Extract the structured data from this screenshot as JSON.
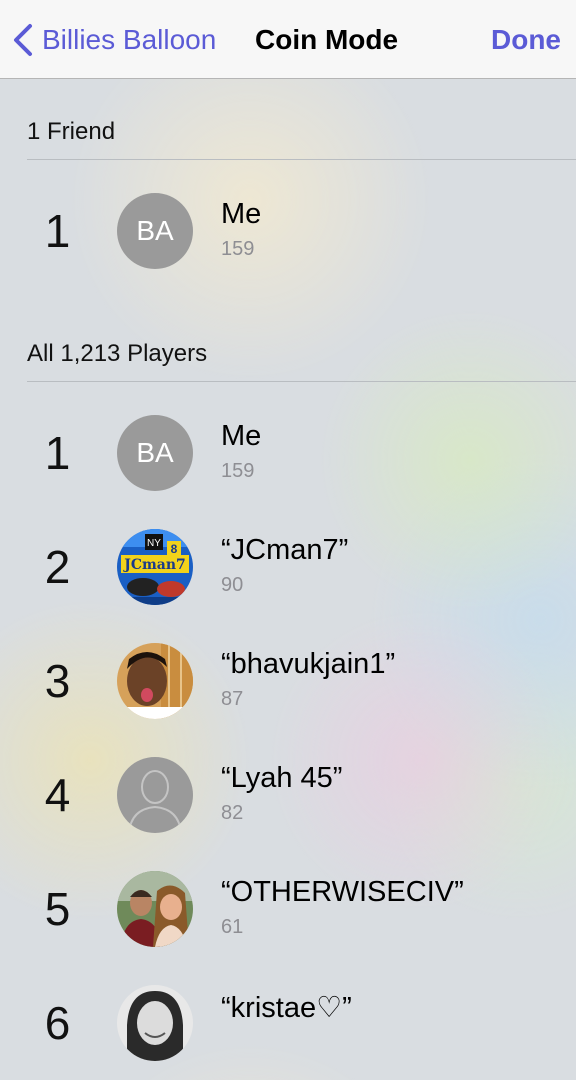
{
  "nav": {
    "back_label": "Billies Balloon",
    "title": "Coin Mode",
    "done_label": "Done"
  },
  "friends_section": {
    "header": "1 Friend",
    "rows": [
      {
        "rank": "1",
        "initials": "BA",
        "name": "Me",
        "score": "159"
      }
    ]
  },
  "players_section": {
    "header": "All 1,213 Players",
    "rows": [
      {
        "rank": "1",
        "initials": "BA",
        "name": "Me",
        "score": "159"
      },
      {
        "rank": "2",
        "name": "“JCman7”",
        "score": "90",
        "avatar_text": "JCman7",
        "avatar_badge": "8",
        "avatar_logo": "NY"
      },
      {
        "rank": "3",
        "name": "“bhavukjain1”",
        "score": "87"
      },
      {
        "rank": "4",
        "name": "“Lyah 45”",
        "score": "82"
      },
      {
        "rank": "5",
        "name": "“OTHERWISECIV”",
        "score": "61"
      },
      {
        "rank": "6",
        "name": "“kristae♡”",
        "score": ""
      }
    ]
  },
  "colors": {
    "accent": "#5b5bd6",
    "avatar_placeholder": "#9a9a9a"
  }
}
